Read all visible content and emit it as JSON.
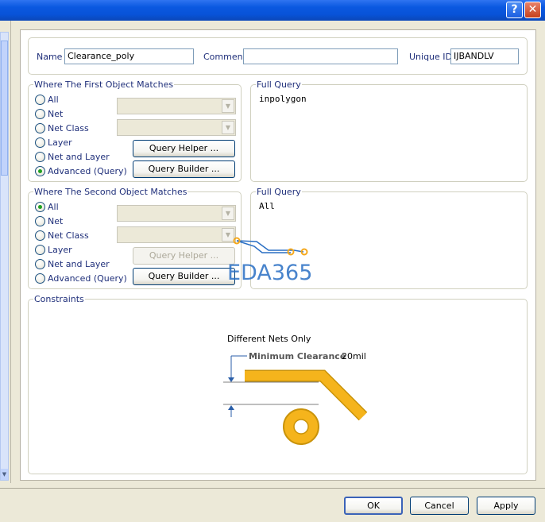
{
  "window": {
    "help_glyph": "?",
    "close_glyph": "✕"
  },
  "rule": {
    "name_label": "Name",
    "name_value": "Clearance_poly",
    "comment_label": "Comment",
    "comment_value": "",
    "uid_label": "Unique ID",
    "uid_value": "IJBANDLV"
  },
  "first_match": {
    "title": "Where The First Object Matches",
    "options": [
      "All",
      "Net",
      "Net Class",
      "Layer",
      "Net and Layer",
      "Advanced (Query)"
    ],
    "selected": "Advanced (Query)",
    "query_helper": "Query Helper ...",
    "query_builder": "Query Builder ...",
    "full_query_title": "Full Query",
    "full_query": "inpolygon"
  },
  "second_match": {
    "title": "Where The Second Object Matches",
    "options": [
      "All",
      "Net",
      "Net Class",
      "Layer",
      "Net and Layer",
      "Advanced (Query)"
    ],
    "selected": "All",
    "query_helper": "Query Helper ...",
    "query_builder": "Query Builder ...",
    "full_query_title": "Full Query",
    "full_query": "All"
  },
  "watermark": "EDA365",
  "constraints": {
    "title": "Constraints",
    "different_nets": "Different Nets Only",
    "min_clearance_label": "Minimum Clearance",
    "min_clearance_value": "20mil"
  },
  "buttons": {
    "ok": "OK",
    "cancel": "Cancel",
    "apply": "Apply"
  },
  "colors": {
    "titlebar": "#0853d8",
    "track": "#f5b41c",
    "watermark": "#2a6fc4",
    "radio_selected": "#21a121"
  }
}
